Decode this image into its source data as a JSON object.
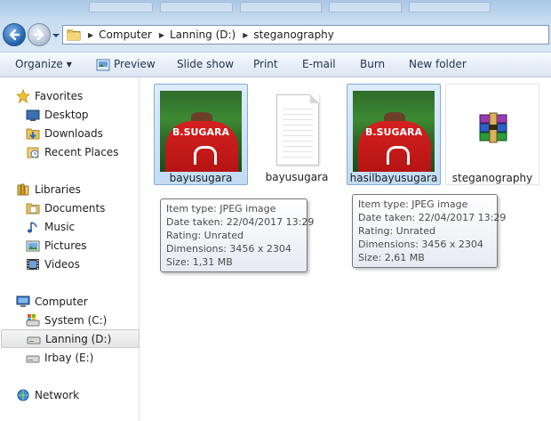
{
  "breadcrumb": [
    "Computer",
    "Lanning (D:)",
    "steganography"
  ],
  "toolbar": {
    "organize": "Organize",
    "preview": "Preview",
    "slideshow": "Slide show",
    "print": "Print",
    "email": "E-mail",
    "burn": "Burn",
    "new_folder": "New folder"
  },
  "nav": {
    "favorites": "Favorites",
    "desktop": "Desktop",
    "downloads": "Downloads",
    "recent_places": "Recent Places",
    "libraries": "Libraries",
    "documents": "Documents",
    "music": "Music",
    "pictures": "Pictures",
    "videos": "Videos",
    "computer": "Computer",
    "system_c": "System (C:)",
    "lanning_d": "Lanning (D:)",
    "irbay_e": "Irbay (E:)",
    "network": "Network"
  },
  "files": [
    {
      "name": "bayusugara",
      "kind": "image",
      "jersey_text": "B.SUGARA"
    },
    {
      "name": "bayusugara",
      "kind": "document"
    },
    {
      "name": "hasilbayusugara",
      "kind": "image",
      "jersey_text": "B.SUGARA"
    },
    {
      "name": "steganography",
      "kind": "archive"
    }
  ],
  "tooltips": [
    {
      "item_type": "Item type: JPEG image",
      "date_taken": "Date taken: 22/04/2017 13:29",
      "rating": "Rating: Unrated",
      "dimensions": "Dimensions: 3456 x 2304",
      "size": "Size: 1,31 MB"
    },
    {
      "item_type": "Item type: JPEG image",
      "date_taken": "Date taken: 22/04/2017 13:29",
      "rating": "Rating: Unrated",
      "dimensions": "Dimensions: 3456 x 2304",
      "size": "Size: 2,61 MB"
    }
  ],
  "colors": {
    "selection_bg": "#cce4fb",
    "selection_border": "#84acdd",
    "jersey": "#d62020"
  }
}
